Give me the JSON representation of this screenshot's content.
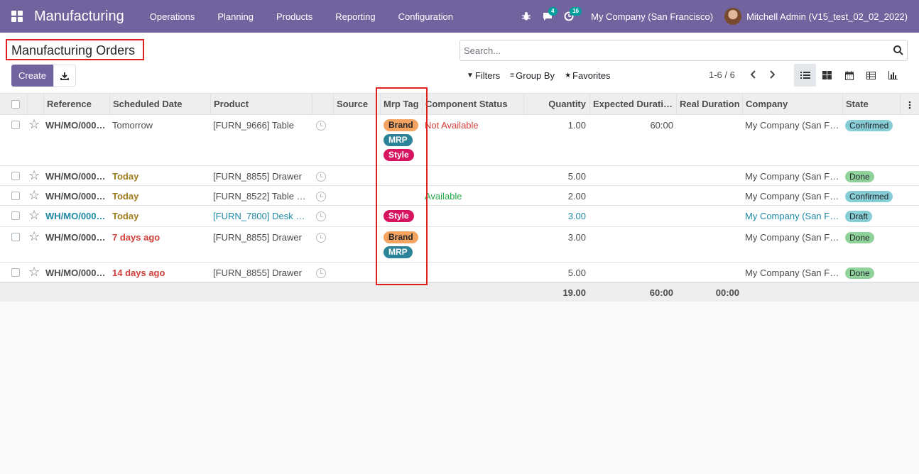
{
  "navbar": {
    "brand": "Manufacturing",
    "menu": [
      "Operations",
      "Planning",
      "Products",
      "Reporting",
      "Configuration"
    ],
    "messages_count": "4",
    "activities_count": "16",
    "company": "My Company (San Francisco)",
    "user": "Mitchell Admin (V15_test_02_02_2022)",
    "bg_color": "#71639e"
  },
  "control_panel": {
    "title": "Manufacturing Orders",
    "create_label": "Create",
    "search_placeholder": "Search...",
    "filters_label": "Filters",
    "group_by_label": "Group By",
    "favorites_label": "Favorites",
    "pager": "1-6 / 6"
  },
  "columns": [
    "Reference",
    "Scheduled Date",
    "Product",
    "Source",
    "Mrp Tag",
    "Component Status",
    "Quantity",
    "Expected Durati…",
    "Real Duration",
    "Company",
    "State"
  ],
  "rows": [
    {
      "reference": "WH/MO/000…",
      "date": "Tomorrow",
      "date_color": "#4c4c4c",
      "date_bold": false,
      "product": "[FURN_9666] Table",
      "source": "",
      "tags": [
        {
          "label": "Brand",
          "bg": "#f4a460",
          "fg": "#212529"
        },
        {
          "label": "MRP",
          "bg": "#2c8397",
          "fg": "#ffffff"
        },
        {
          "label": "Style",
          "bg": "#d6145f",
          "fg": "#ffffff"
        }
      ],
      "component_status": "Not Available",
      "component_color": "#d23f3a",
      "quantity": "1.00",
      "expected": "60:00",
      "real": "",
      "company": "My Company (San F…",
      "state": "Confirmed",
      "state_bg": "#87cdd6",
      "link": false
    },
    {
      "reference": "WH/MO/000…",
      "date": "Today",
      "date_color": "#a07b1f",
      "date_bold": true,
      "product": "[FURN_8855] Drawer",
      "source": "",
      "tags": [],
      "component_status": "",
      "component_color": "#4c4c4c",
      "quantity": "5.00",
      "expected": "",
      "real": "",
      "company": "My Company (San F…",
      "state": "Done",
      "state_bg": "#8fd39b",
      "link": false
    },
    {
      "reference": "WH/MO/000…",
      "date": "Today",
      "date_color": "#a07b1f",
      "date_bold": true,
      "product": "[FURN_8522] Table …",
      "source": "",
      "tags": [],
      "component_status": "Available",
      "component_color": "#28a745",
      "quantity": "2.00",
      "expected": "",
      "real": "",
      "company": "My Company (San F…",
      "state": "Confirmed",
      "state_bg": "#87cdd6",
      "link": false
    },
    {
      "reference": "WH/MO/000…",
      "date": "Today",
      "date_color": "#a07b1f",
      "date_bold": true,
      "product": "[FURN_7800] Desk …",
      "source": "",
      "tags": [
        {
          "label": "Style",
          "bg": "#d6145f",
          "fg": "#ffffff"
        }
      ],
      "component_status": "",
      "component_color": "#4c4c4c",
      "quantity": "3.00",
      "expected": "",
      "real": "",
      "company": "My Company (San F…",
      "state": "Draft",
      "state_bg": "#87cdd6",
      "link": true
    },
    {
      "reference": "WH/MO/000…",
      "date": "7 days ago",
      "date_color": "#d23f3a",
      "date_bold": true,
      "product": "[FURN_8855] Drawer",
      "source": "",
      "tags": [
        {
          "label": "Brand",
          "bg": "#f4a460",
          "fg": "#212529"
        },
        {
          "label": "MRP",
          "bg": "#2c8397",
          "fg": "#ffffff"
        }
      ],
      "component_status": "",
      "component_color": "#4c4c4c",
      "quantity": "3.00",
      "expected": "",
      "real": "",
      "company": "My Company (San F…",
      "state": "Done",
      "state_bg": "#8fd39b",
      "link": false
    },
    {
      "reference": "WH/MO/000…",
      "date": "14 days ago",
      "date_color": "#d23f3a",
      "date_bold": true,
      "product": "[FURN_8855] Drawer",
      "source": "",
      "tags": [],
      "component_status": "",
      "component_color": "#4c4c4c",
      "quantity": "5.00",
      "expected": "",
      "real": "",
      "company": "My Company (San F…",
      "state": "Done",
      "state_bg": "#8fd39b",
      "link": false
    }
  ],
  "totals": {
    "quantity": "19.00",
    "expected": "60:00",
    "real": "00:00"
  },
  "link_color": "#1f8aa6"
}
